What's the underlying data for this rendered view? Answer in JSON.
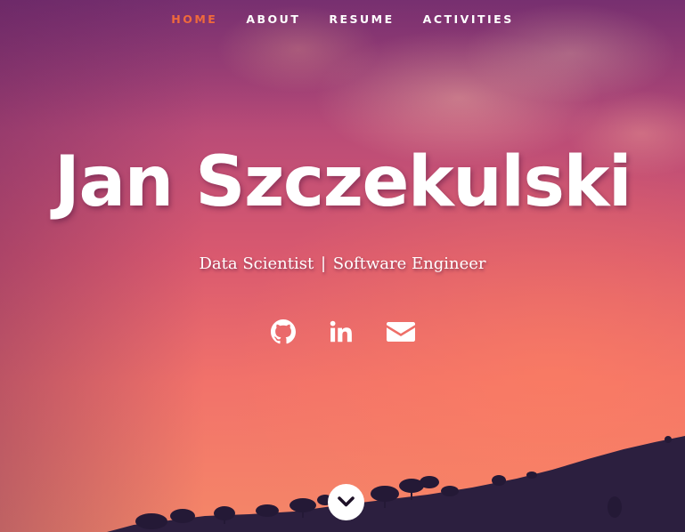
{
  "nav": {
    "items": [
      {
        "label": "HOME",
        "active": true
      },
      {
        "label": "ABOUT",
        "active": false
      },
      {
        "label": "RESUME",
        "active": false
      },
      {
        "label": "ACTIVITIES",
        "active": false
      }
    ],
    "active_color": "#f06a3b"
  },
  "hero": {
    "name": "Jan Szczekulski",
    "subtitle_left": "Data Scientist",
    "subtitle_separator": "|",
    "subtitle_right": "Software Engineer"
  },
  "social_links": [
    {
      "icon": "github-icon"
    },
    {
      "icon": "linkedin-icon"
    },
    {
      "icon": "envelope-icon"
    }
  ],
  "scroll_button": {
    "icon": "chevron-down-icon"
  }
}
